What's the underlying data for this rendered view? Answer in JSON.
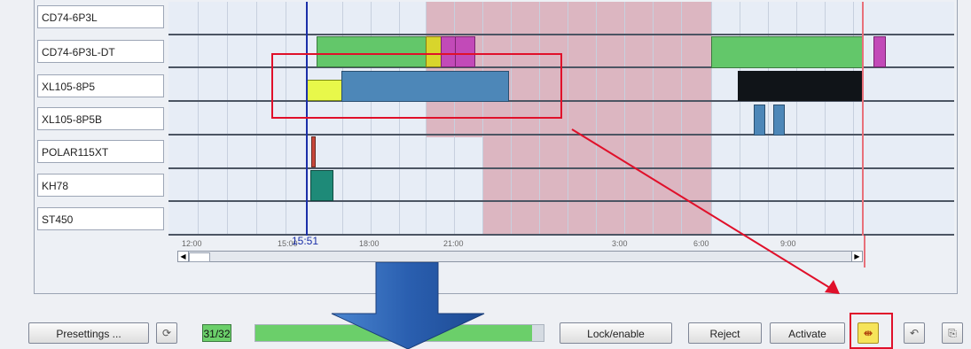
{
  "rows": [
    {
      "label": "CD74-6P3L"
    },
    {
      "label": "CD74-6P3L-DT"
    },
    {
      "label": "XL105-8P5"
    },
    {
      "label": "XL105-8P5B"
    },
    {
      "label": "POLAR115XT"
    },
    {
      "label": "KH78"
    },
    {
      "label": "ST450"
    }
  ],
  "timeline": {
    "ticks": [
      "12:00",
      "15:00",
      "18:00",
      "21:00",
      "3:00",
      "6:00",
      "9:00"
    ],
    "now_label": "15:51"
  },
  "toolbar": {
    "presettings_label": "Presettings ...",
    "counter": "31/32",
    "progress": 0.96,
    "lock_label": "Lock/enable",
    "reject_label": "Reject",
    "activate_label": "Activate"
  },
  "colors": {
    "now_line": "#1b2fa8",
    "blocked_shade": "#dcb6c1",
    "highlight": "#e0102a",
    "job_green": "#63c76a",
    "job_blue": "#4d87b8",
    "progress": "#6bcf6a",
    "arrow": "#2e66b8"
  },
  "icons": {
    "refresh": "refresh-icon",
    "zoom_fit": "zoom-fit-icon",
    "undo": "undo-icon",
    "export": "export-icon"
  }
}
